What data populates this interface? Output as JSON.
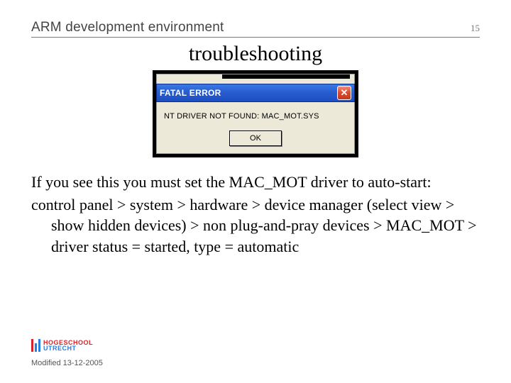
{
  "header": {
    "title": "ARM development environment",
    "page": "15"
  },
  "subtitle": "troubleshooting",
  "dialog": {
    "title": "FATAL ERROR",
    "message": "NT DRIVER NOT FOUND: MAC_MOT.SYS",
    "ok": "OK",
    "close_glyph": "✕"
  },
  "body": {
    "p1": "If you see this you must set the MAC_MOT driver to auto-start:",
    "p2": "control panel > system > hardware > device manager (select view > show hidden devices) > non plug-and-pray devices > MAC_MOT > driver status = started, type = automatic"
  },
  "logo": {
    "line1": "HOGESCHOOL",
    "line2": "UTRECHT"
  },
  "footer": {
    "modified": "Modified 13-12-2005"
  }
}
